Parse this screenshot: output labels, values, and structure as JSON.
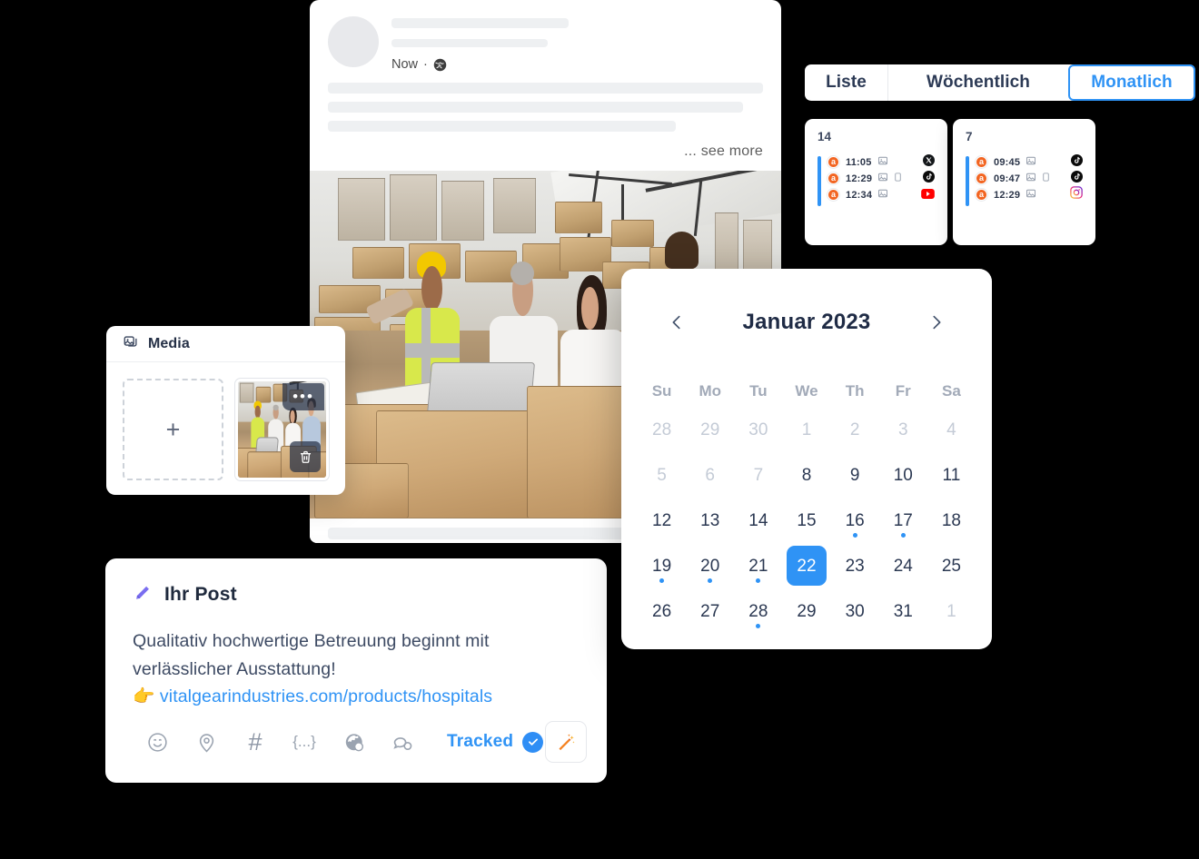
{
  "post_preview": {
    "timestamp": "Now",
    "separator": "·",
    "audience_icon": "globe-icon",
    "see_more": "... see more",
    "photo_alt": "warehouse-team-photo"
  },
  "media_card": {
    "title": "Media",
    "title_icon": "images-icon",
    "add_button": "+",
    "thumb_more_icon": "more-dots-icon",
    "thumb_delete_icon": "trash-icon"
  },
  "composer": {
    "title": "Ihr Post",
    "title_icon": "pencil-icon",
    "text_line1": "Qualitativ hochwertige Betreuung beginnt mit",
    "text_line2": "verlässlicher Ausstattung!",
    "pointer_emoji": "👉",
    "link": "vitalgearindustries.com/products/hospitals",
    "link_color": "#2f93f5",
    "tools": [
      {
        "name": "emoji-icon",
        "label": ""
      },
      {
        "name": "location-pin-icon",
        "label": ""
      },
      {
        "name": "hashtag-icon",
        "label": "#"
      },
      {
        "name": "variable-icon",
        "label": "{...}"
      },
      {
        "name": "globe-icon",
        "label": ""
      },
      {
        "name": "comment-icon",
        "label": ""
      }
    ],
    "tracked_label": "Tracked",
    "tracked_checked": true,
    "magic_button_icon": "magic-wand-icon"
  },
  "tabs": {
    "items": [
      {
        "label": "Liste",
        "active": false
      },
      {
        "label": "Wöchentlich",
        "active": false
      },
      {
        "label": "Monatlich",
        "active": true
      }
    ],
    "active_color": "#2f93f5"
  },
  "schedule_cards": [
    {
      "day": "14",
      "events": [
        {
          "avatar": "a",
          "time": "11:05",
          "attachments": [
            "image-icon"
          ],
          "platform": "x-icon"
        },
        {
          "avatar": "a",
          "time": "12:29",
          "attachments": [
            "image-icon",
            "mobile-icon"
          ],
          "platform": "tiktok-icon"
        },
        {
          "avatar": "a",
          "time": "12:34",
          "attachments": [
            "image-icon"
          ],
          "platform": "youtube-icon"
        }
      ]
    },
    {
      "day": "7",
      "events": [
        {
          "avatar": "a",
          "time": "09:45",
          "attachments": [
            "image-icon"
          ],
          "platform": "tiktok-icon"
        },
        {
          "avatar": "a",
          "time": "09:47",
          "attachments": [
            "image-icon",
            "mobile-icon"
          ],
          "platform": "tiktok-icon"
        },
        {
          "avatar": "a",
          "time": "12:29",
          "attachments": [
            "image-icon"
          ],
          "platform": "instagram-icon"
        }
      ]
    }
  ],
  "calendar": {
    "title": "Januar 2023",
    "prev_icon": "chevron-left-icon",
    "next_icon": "chevron-right-icon",
    "dow": [
      "Su",
      "Mo",
      "Tu",
      "We",
      "Th",
      "Fr",
      "Sa"
    ],
    "selected_day": 22,
    "accent": "#2f93f5",
    "days": [
      {
        "n": "28",
        "muted": true
      },
      {
        "n": "29",
        "muted": true
      },
      {
        "n": "30",
        "muted": true
      },
      {
        "n": "1",
        "muted": true
      },
      {
        "n": "2",
        "muted": true
      },
      {
        "n": "3",
        "muted": true
      },
      {
        "n": "4",
        "muted": true
      },
      {
        "n": "5",
        "muted": true
      },
      {
        "n": "6",
        "muted": true
      },
      {
        "n": "7",
        "muted": true
      },
      {
        "n": "8"
      },
      {
        "n": "9"
      },
      {
        "n": "10"
      },
      {
        "n": "11"
      },
      {
        "n": "12"
      },
      {
        "n": "13"
      },
      {
        "n": "14"
      },
      {
        "n": "15"
      },
      {
        "n": "16",
        "dot": true
      },
      {
        "n": "17",
        "dot": true
      },
      {
        "n": "18"
      },
      {
        "n": "19",
        "dot": true
      },
      {
        "n": "20",
        "dot": true
      },
      {
        "n": "21",
        "dot": true
      },
      {
        "n": "22",
        "selected": true
      },
      {
        "n": "23"
      },
      {
        "n": "24"
      },
      {
        "n": "25"
      },
      {
        "n": "26"
      },
      {
        "n": "27"
      },
      {
        "n": "28",
        "dot": true
      },
      {
        "n": "29"
      },
      {
        "n": "30"
      },
      {
        "n": "31"
      },
      {
        "n": "1",
        "muted": true
      }
    ]
  }
}
